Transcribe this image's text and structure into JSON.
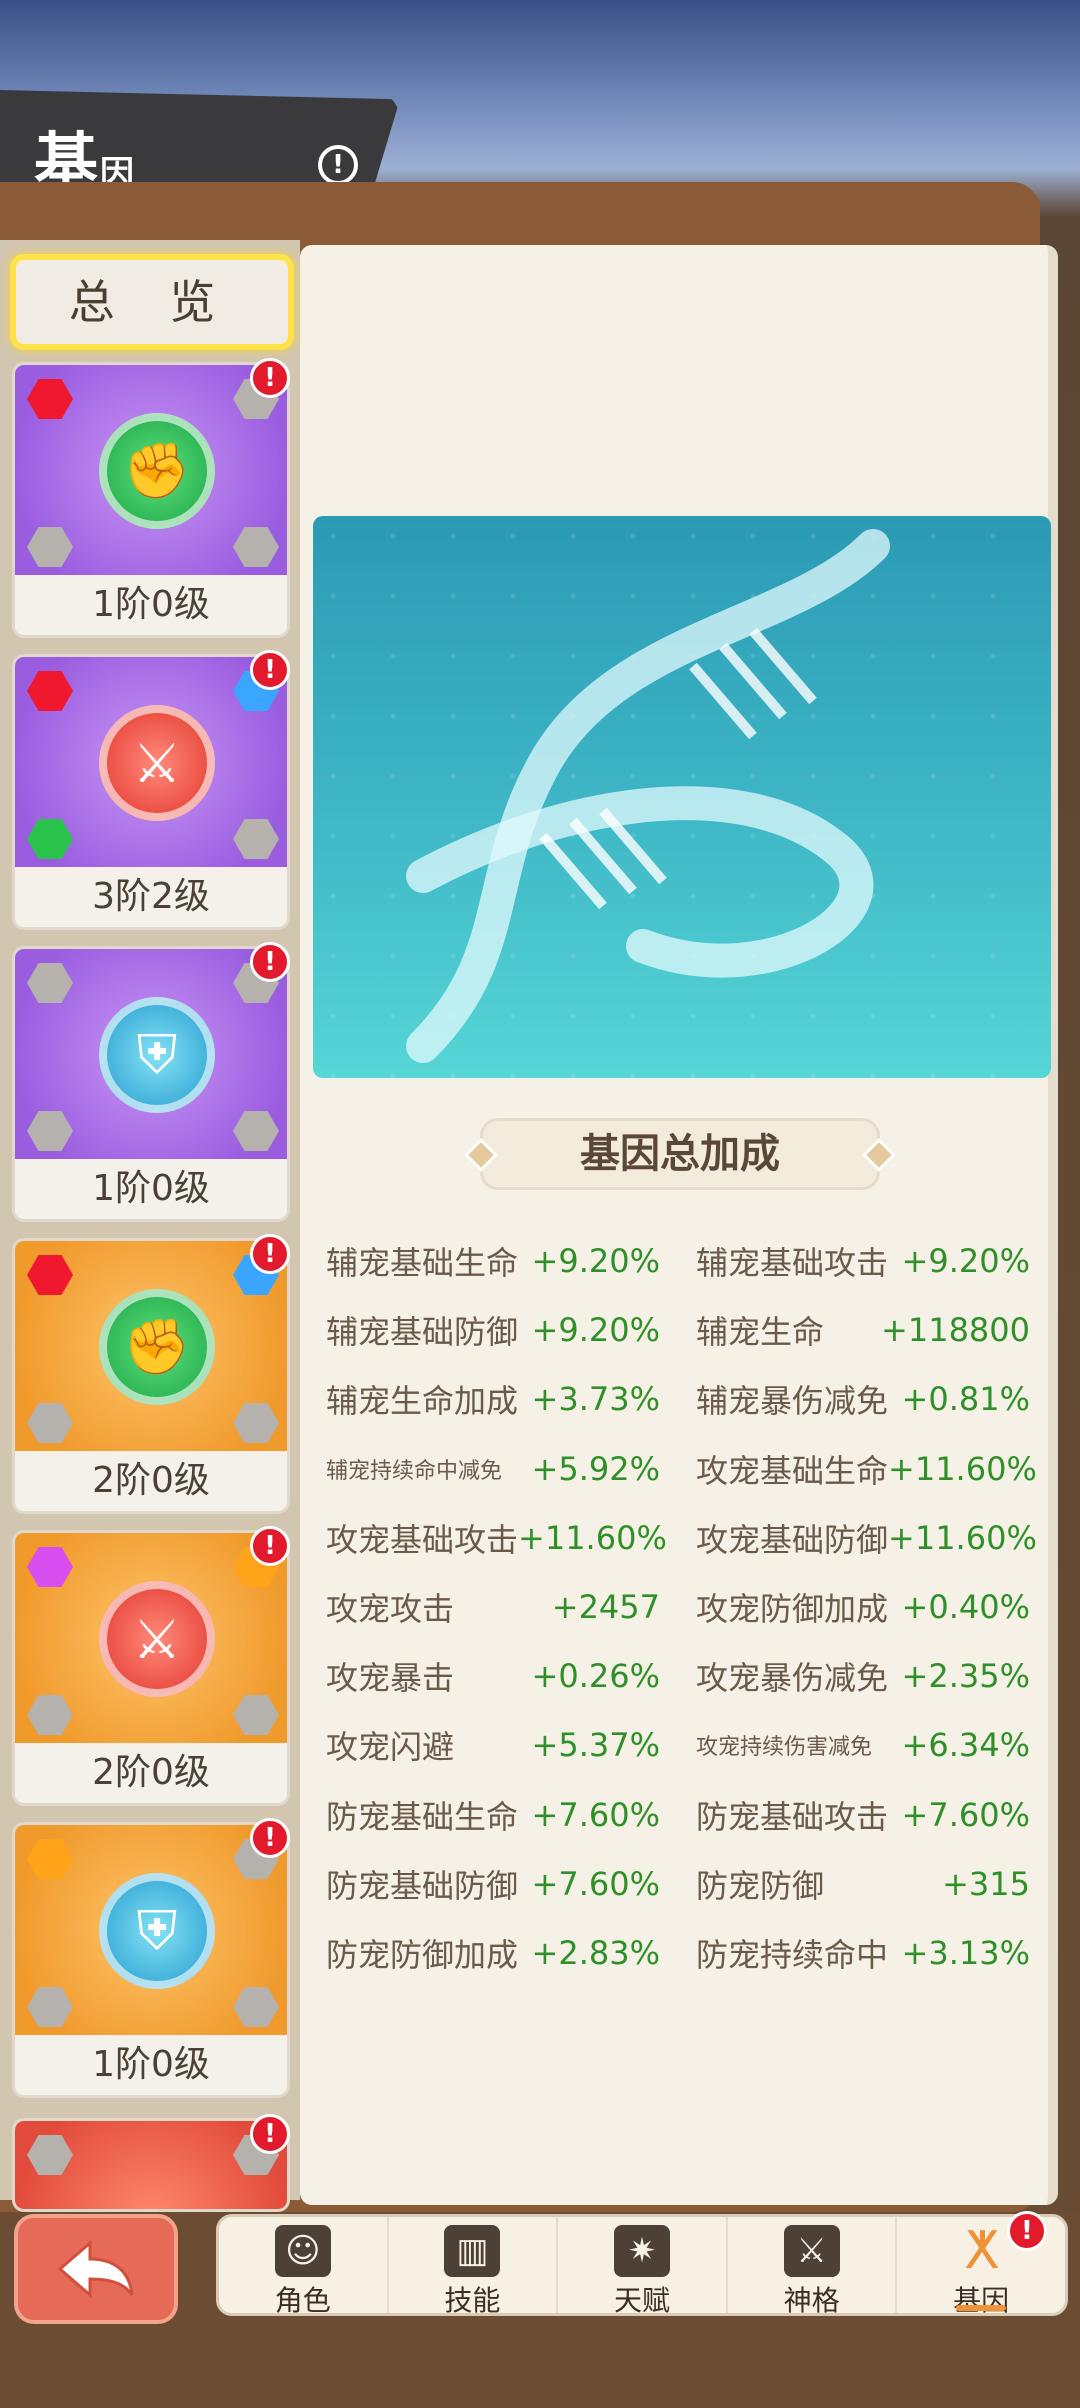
{
  "header": {
    "title_big": "基",
    "title_small": "因",
    "info_symbol": "!"
  },
  "sidebar": {
    "overview_label": "总 览",
    "cards": [
      {
        "label": "1阶0级",
        "theme": "purple",
        "emblem": "fist-bump-icon",
        "emblem_color": "green",
        "slots": [
          "red",
          "gray",
          "gray",
          "gray"
        ],
        "alert": "!"
      },
      {
        "label": "3阶2级",
        "theme": "purple",
        "emblem": "crossed-swords-icon",
        "emblem_color": "red",
        "slots": [
          "red",
          "blue",
          "green",
          "gray"
        ],
        "alert": "!"
      },
      {
        "label": "1阶0级",
        "theme": "purple",
        "emblem": "sword-shield-icon",
        "emblem_color": "blue",
        "slots": [
          "gray",
          "gray",
          "gray",
          "gray"
        ],
        "alert": "!"
      },
      {
        "label": "2阶0级",
        "theme": "orange",
        "emblem": "fist-bump-icon",
        "emblem_color": "green",
        "slots": [
          "red",
          "blue",
          "gray",
          "gray"
        ],
        "alert": "!"
      },
      {
        "label": "2阶0级",
        "theme": "orange",
        "emblem": "crossed-swords-icon",
        "emblem_color": "red",
        "slots": [
          "purple",
          "orange",
          "gray",
          "gray"
        ],
        "alert": "!"
      },
      {
        "label": "1阶0级",
        "theme": "orange",
        "emblem": "sword-shield-icon",
        "emblem_color": "blue",
        "slots": [
          "orange",
          "gray",
          "gray",
          "gray"
        ],
        "alert": "!"
      }
    ]
  },
  "main": {
    "section_title": "基因总加成",
    "stats_left": [
      {
        "label": "辅宠基础生命",
        "value": "+9.20%"
      },
      {
        "label": "辅宠基础防御",
        "value": "+9.20%"
      },
      {
        "label": "辅宠生命加成",
        "value": "+3.73%"
      },
      {
        "label": "辅宠持续命中减免",
        "value": "+5.92%",
        "small": true
      },
      {
        "label": "攻宠基础攻击",
        "value": "+11.60%"
      },
      {
        "label": "攻宠攻击",
        "value": "+2457"
      },
      {
        "label": "攻宠暴击",
        "value": "+0.26%"
      },
      {
        "label": "攻宠闪避",
        "value": "+5.37%"
      },
      {
        "label": "防宠基础生命",
        "value": "+7.60%"
      },
      {
        "label": "防宠基础防御",
        "value": "+7.60%"
      },
      {
        "label": "防宠防御加成",
        "value": "+2.83%"
      }
    ],
    "stats_right": [
      {
        "label": "辅宠基础攻击",
        "value": "+9.20%"
      },
      {
        "label": "辅宠生命",
        "value": "+118800"
      },
      {
        "label": "辅宠暴伤减免",
        "value": "+0.81%"
      },
      {
        "label": "攻宠基础生命",
        "value": "+11.60%"
      },
      {
        "label": "攻宠基础防御",
        "value": "+11.60%"
      },
      {
        "label": "攻宠防御加成",
        "value": "+0.40%"
      },
      {
        "label": "攻宠暴伤减免",
        "value": "+2.35%"
      },
      {
        "label": "攻宠持续伤害减免",
        "value": "+6.34%",
        "small": true
      },
      {
        "label": "防宠基础攻击",
        "value": "+7.60%"
      },
      {
        "label": "防宠防御",
        "value": "+315"
      },
      {
        "label": "防宠持续命中",
        "value": "+3.13%"
      }
    ]
  },
  "bottom_nav": {
    "back_icon": "back-arrow-icon",
    "tabs": [
      {
        "label": "角色",
        "icon": "character-icon"
      },
      {
        "label": "技能",
        "icon": "skill-book-icon"
      },
      {
        "label": "天赋",
        "icon": "talent-tree-icon"
      },
      {
        "label": "神格",
        "icon": "divinity-icon"
      },
      {
        "label": "基因",
        "icon": "dna-icon",
        "active": true,
        "alert": "!"
      }
    ]
  },
  "colors": {
    "value_green": "#2f8f28",
    "label_brown": "#6a5a4a",
    "highlight_yellow": "#ffe24a",
    "alert_red": "#e21a2c"
  }
}
